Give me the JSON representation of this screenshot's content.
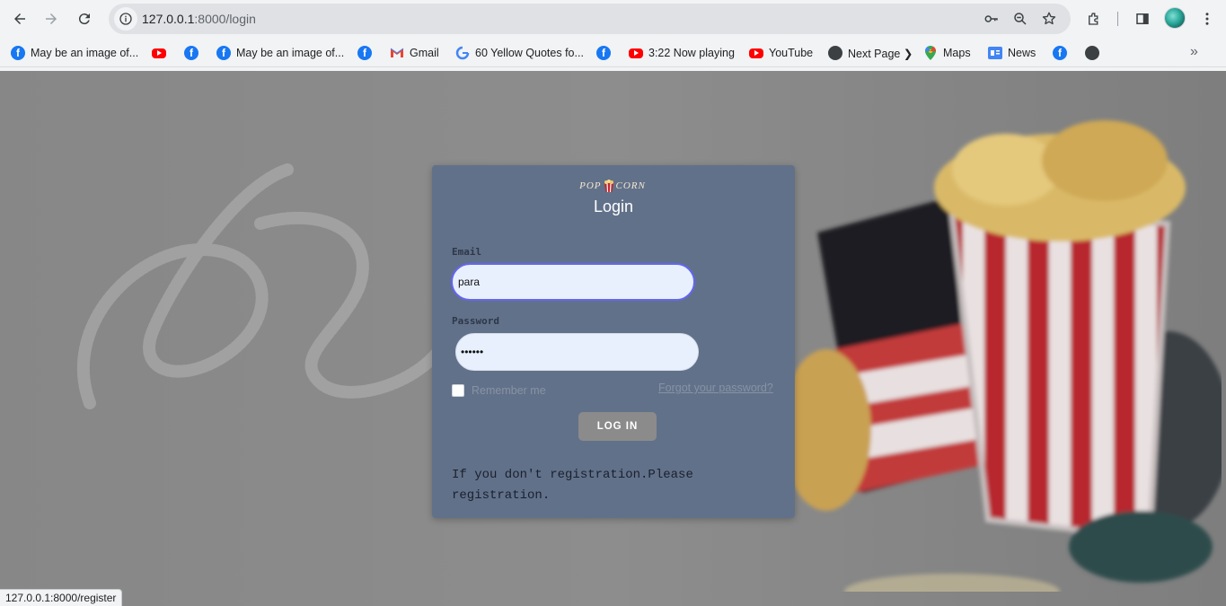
{
  "browser": {
    "url_host": "127.0.0.1",
    "url_path": ":8000/login",
    "status_url": "127.0.0.1:8000/register"
  },
  "bookmarks": [
    {
      "label": "May be an image of...",
      "icon": "facebook-icon"
    },
    {
      "label": "",
      "icon": "youtube-icon"
    },
    {
      "label": "",
      "icon": "facebook-icon"
    },
    {
      "label": "May be an image of...",
      "icon": "facebook-icon"
    },
    {
      "label": "",
      "icon": "facebook-icon"
    },
    {
      "label": "Gmail",
      "icon": "gmail-icon"
    },
    {
      "label": "60 Yellow Quotes fo...",
      "icon": "google-icon"
    },
    {
      "label": "",
      "icon": "facebook-icon"
    },
    {
      "label": "3:22 Now playing",
      "icon": "youtube-icon"
    },
    {
      "label": "YouTube",
      "icon": "youtube-icon"
    },
    {
      "label": "Next Page ❯",
      "icon": "globe-icon"
    },
    {
      "label": "Maps",
      "icon": "maps-icon"
    },
    {
      "label": "News",
      "icon": "news-icon"
    },
    {
      "label": "",
      "icon": "facebook-icon"
    },
    {
      "label": "",
      "icon": "globe-icon"
    }
  ],
  "login": {
    "logo_left": "POP",
    "logo_right": "CORN",
    "title": "Login",
    "email_label": "Email",
    "email_value": "para",
    "password_label": "Password",
    "password_value": "••••••",
    "remember_label": "Remember me",
    "forgot_label": "Forgot your password?",
    "login_button": "LOG IN",
    "register_note": "If you don't registration.Please registration."
  },
  "colors": {
    "card_bg": "#62718a",
    "input_bg": "#e8f0fe",
    "focus_ring": "#6366f1",
    "button_bg": "#8b8b8b"
  }
}
